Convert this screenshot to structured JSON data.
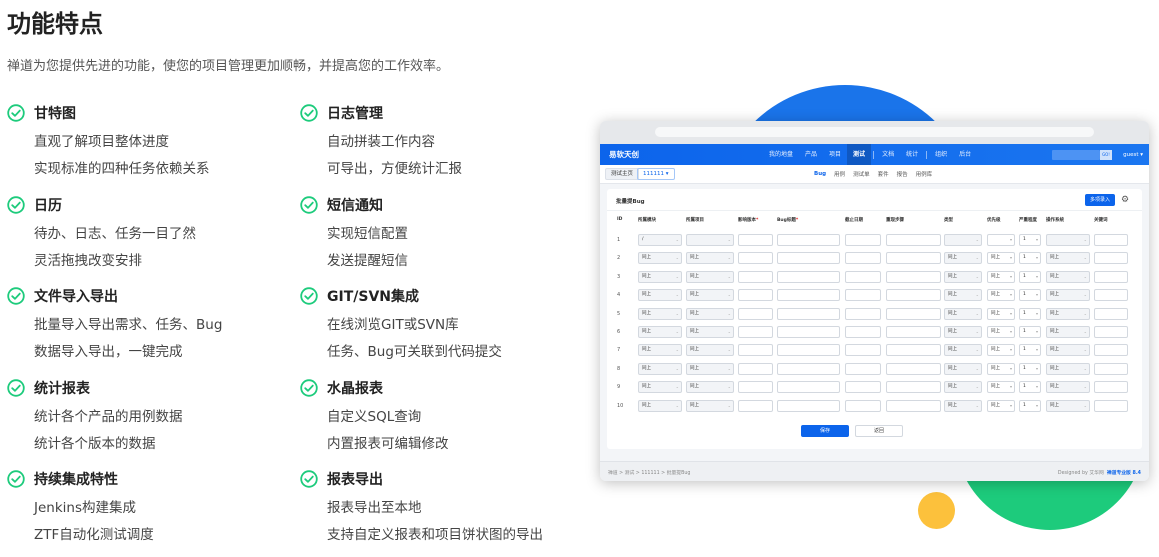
{
  "header": {
    "title": "功能特点",
    "description": "禅道为您提供先进的功能，使您的项目管理更加顺畅，并提高您的工作效率。"
  },
  "features": [
    {
      "title": "甘特图",
      "lines": [
        "直观了解项目整体进度",
        "实现标准的四种任务依赖关系"
      ]
    },
    {
      "title": "日志管理",
      "lines": [
        "自动拼装工作内容",
        "可导出，方便统计汇报"
      ]
    },
    {
      "title": "日历",
      "lines": [
        "待办、日志、任务一目了然",
        "灵活拖拽改变安排"
      ]
    },
    {
      "title": "短信通知",
      "lines": [
        "实现短信配置",
        "发送提醒短信"
      ]
    },
    {
      "title": "文件导入导出",
      "lines": [
        "批量导入导出需求、任务、Bug",
        "数据导入导出，一键完成"
      ]
    },
    {
      "title": "GIT/SVN集成",
      "lines": [
        "在线浏览GIT或SVN库",
        "任务、Bug可关联到代码提交"
      ]
    },
    {
      "title": "统计报表",
      "lines": [
        "统计各个产品的用例数据",
        "统计各个版本的数据"
      ]
    },
    {
      "title": "水晶报表",
      "lines": [
        "自定义SQL查询",
        "内置报表可编辑修改"
      ]
    },
    {
      "title": "持续集成特性",
      "lines": [
        "Jenkins构建集成",
        "ZTF自动化测试调度"
      ]
    },
    {
      "title": "报表导出",
      "lines": [
        "报表导出至本地",
        "支持自定义报表和项目饼状图的导出"
      ]
    }
  ],
  "colors": {
    "accent_green": "#1dcb7c",
    "brand_blue": "#0c64eb",
    "circle_blue": "#1a74ea",
    "circle_yellow": "#fcc13c"
  },
  "app": {
    "logo": "易软天创",
    "nav": [
      "我的地盘",
      "产品",
      "项目",
      "测试",
      "文档",
      "统计",
      "组织",
      "后台"
    ],
    "nav_active": "测试",
    "search_button": "GO!",
    "user": "guest ▾",
    "crumb_home": "测试主页",
    "crumb_project": "111111 ▾",
    "sub_nav": [
      "Bug",
      "用例",
      "测试单",
      "套件",
      "报告",
      "用例库"
    ],
    "sub_nav_active": "Bug",
    "panel_title": "批量提Bug",
    "batch_button": "多项录入",
    "columns": [
      "ID",
      "所属模块",
      "所属项目",
      "影响版本",
      "Bug标题",
      "截止日期",
      "重现步骤",
      "类型",
      "优先级",
      "严重程度",
      "操作系统",
      "关键词"
    ],
    "required_marker": "*",
    "first_row_module": "/",
    "same_as_above": "同上",
    "default_level": "1",
    "rows": [
      "1",
      "2",
      "3",
      "4",
      "5",
      "6",
      "7",
      "8",
      "9",
      "10"
    ],
    "save_button": "保存",
    "back_button": "返回",
    "footer_crumb": "禅道 > 测试 > 111111 > 批量提Bug",
    "footer_designed": "Designed by 艾华网",
    "footer_version": "禅道专业版 8.4"
  }
}
